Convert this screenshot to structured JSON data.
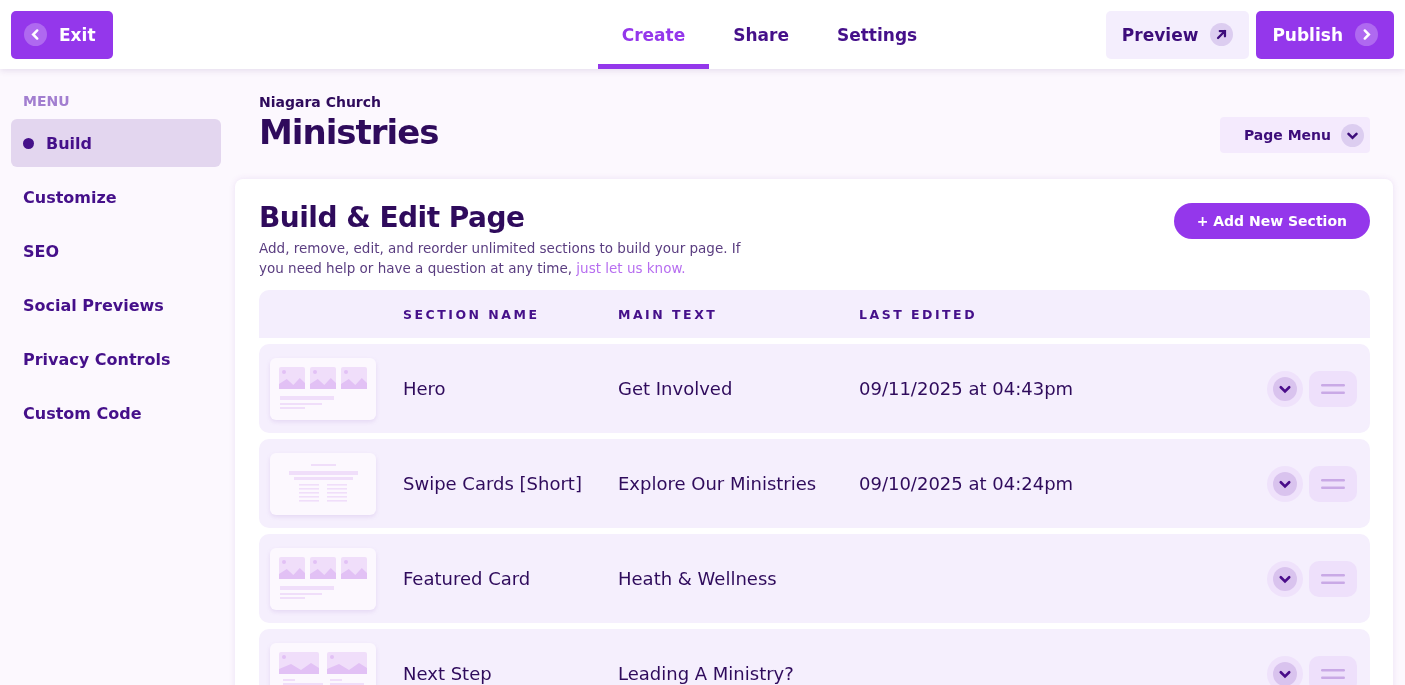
{
  "topbar": {
    "exit": "Exit",
    "tabs": [
      {
        "label": "Create",
        "selected": true
      },
      {
        "label": "Share",
        "selected": false
      },
      {
        "label": "Settings",
        "selected": false
      }
    ],
    "preview": "Preview",
    "publish": "Publish"
  },
  "sidebar": {
    "heading": "MENU",
    "items": [
      {
        "label": "Build",
        "selected": true
      },
      {
        "label": "Customize",
        "selected": false
      },
      {
        "label": "SEO",
        "selected": false
      },
      {
        "label": "Social Previews",
        "selected": false
      },
      {
        "label": "Privacy Controls",
        "selected": false
      },
      {
        "label": "Custom Code",
        "selected": false
      }
    ]
  },
  "page": {
    "site": "Niagara Church",
    "title": "Ministries",
    "menu_button": "Page Menu"
  },
  "panel": {
    "title": "Build & Edit Page",
    "description": "Add, remove, edit, and reorder unlimited sections to build your page. If you need help or have a question at any time, ",
    "link": "just let us know.",
    "add_button": "+ Add New Section"
  },
  "table": {
    "columns": [
      "SECTION NAME",
      "MAIN TEXT",
      "LAST EDITED"
    ],
    "rows": [
      {
        "kind": "three-images",
        "name": "Hero",
        "main_text": "Get Involved",
        "last_edited": "09/11/2025 at 04:43pm"
      },
      {
        "kind": "text-columns",
        "name": "Swipe Cards [Short]",
        "main_text": "Explore Our Ministries",
        "last_edited": "09/10/2025 at 04:24pm"
      },
      {
        "kind": "three-images",
        "name": "Featured Card",
        "main_text": "Heath & Wellness"
      },
      {
        "kind": "two-images",
        "name": "Next Step",
        "main_text": "Leading A Ministry?"
      }
    ]
  }
}
